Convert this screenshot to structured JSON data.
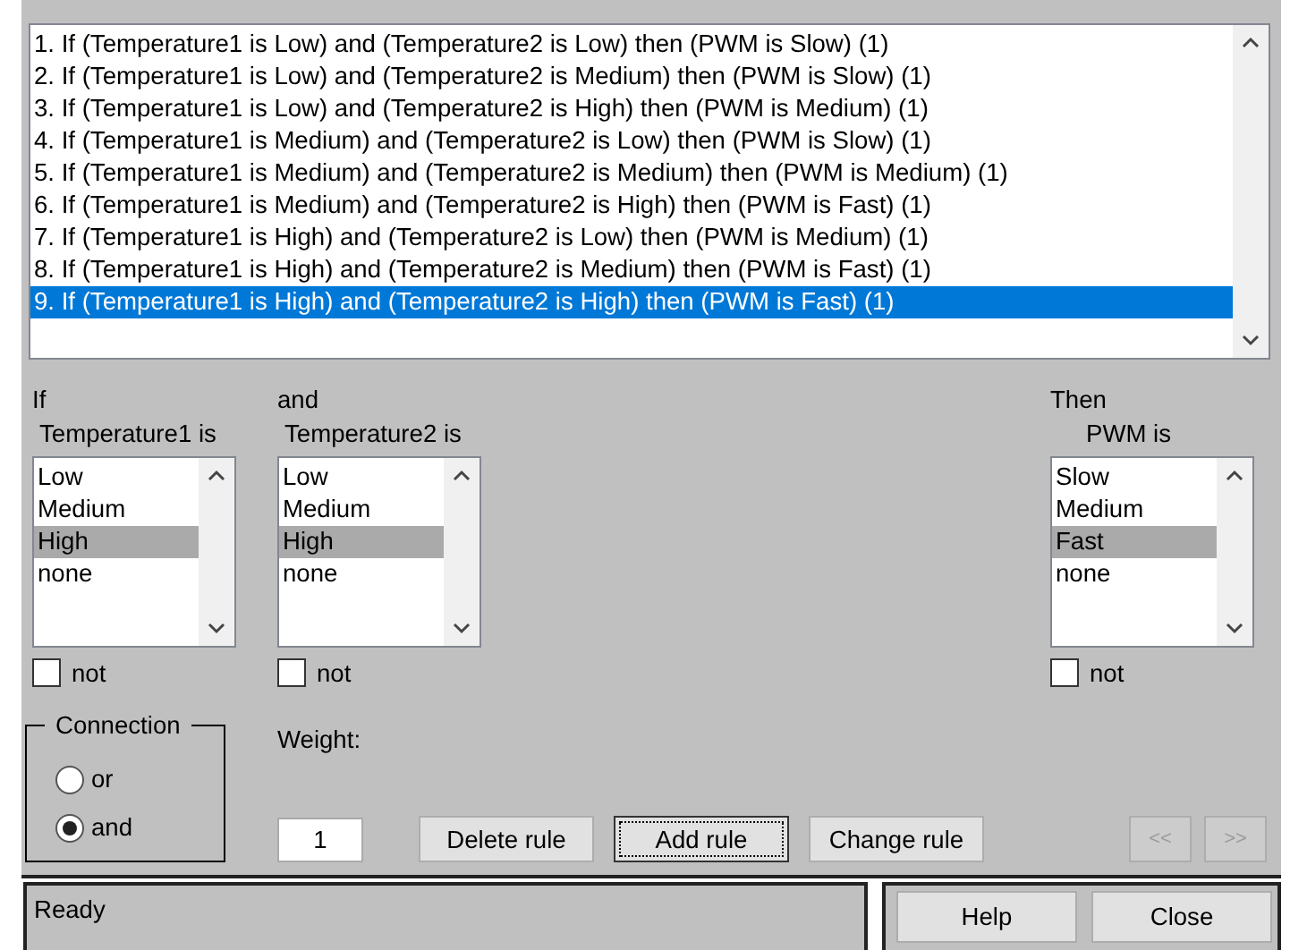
{
  "rules": [
    {
      "text": "1. If (Temperature1 is Low) and (Temperature2 is Low) then (PWM is Slow) (1)",
      "selected": false
    },
    {
      "text": "2. If (Temperature1 is Low) and (Temperature2 is Medium) then (PWM is Slow) (1)",
      "selected": false
    },
    {
      "text": "3. If (Temperature1 is Low) and (Temperature2 is High) then (PWM is Medium) (1)",
      "selected": false
    },
    {
      "text": "4. If (Temperature1 is Medium) and (Temperature2 is Low) then (PWM is Slow) (1)",
      "selected": false
    },
    {
      "text": "5. If (Temperature1 is Medium) and (Temperature2 is Medium) then (PWM is Medium) (1)",
      "selected": false
    },
    {
      "text": "6. If (Temperature1 is Medium) and (Temperature2 is High) then (PWM is Fast) (1)",
      "selected": false
    },
    {
      "text": "7. If (Temperature1 is High) and (Temperature2 is Low) then (PWM is Medium) (1)",
      "selected": false
    },
    {
      "text": "8. If (Temperature1 is High) and (Temperature2 is Medium) then (PWM is Fast) (1)",
      "selected": false
    },
    {
      "text": "9. If (Temperature1 is High) and (Temperature2 is High) then (PWM is Fast) (1)",
      "selected": true
    }
  ],
  "variables": [
    {
      "kind": "input",
      "header": "If",
      "name": "Temperature1 is",
      "options": [
        {
          "label": "Low",
          "selected": false
        },
        {
          "label": "Medium",
          "selected": false
        },
        {
          "label": "High",
          "selected": true
        },
        {
          "label": "none",
          "selected": false
        }
      ],
      "not": {
        "label": "not",
        "checked": false
      }
    },
    {
      "kind": "input",
      "header": "and",
      "name": "Temperature2 is",
      "options": [
        {
          "label": "Low",
          "selected": false
        },
        {
          "label": "Medium",
          "selected": false
        },
        {
          "label": "High",
          "selected": true
        },
        {
          "label": "none",
          "selected": false
        }
      ],
      "not": {
        "label": "not",
        "checked": false
      }
    },
    {
      "kind": "output",
      "header": "Then",
      "name": "PWM is",
      "options": [
        {
          "label": "Slow",
          "selected": false
        },
        {
          "label": "Medium",
          "selected": false
        },
        {
          "label": "Fast",
          "selected": true
        },
        {
          "label": "none",
          "selected": false
        }
      ],
      "not": {
        "label": "not",
        "checked": false
      }
    }
  ],
  "connection": {
    "title": "Connection",
    "options": [
      {
        "label": "or",
        "selected": false
      },
      {
        "label": "and",
        "selected": true
      }
    ]
  },
  "weight": {
    "label": "Weight:",
    "value": "1"
  },
  "buttons": [
    {
      "label": "Delete rule",
      "focused": false
    },
    {
      "label": "Add rule",
      "focused": true
    },
    {
      "label": "Change rule",
      "focused": false
    }
  ],
  "nav_buttons": [
    {
      "label": "<<",
      "disabled": true
    },
    {
      "label": ">>",
      "disabled": true
    }
  ],
  "status": "Ready",
  "footer_buttons": [
    {
      "label": "Help"
    },
    {
      "label": "Close"
    }
  ]
}
